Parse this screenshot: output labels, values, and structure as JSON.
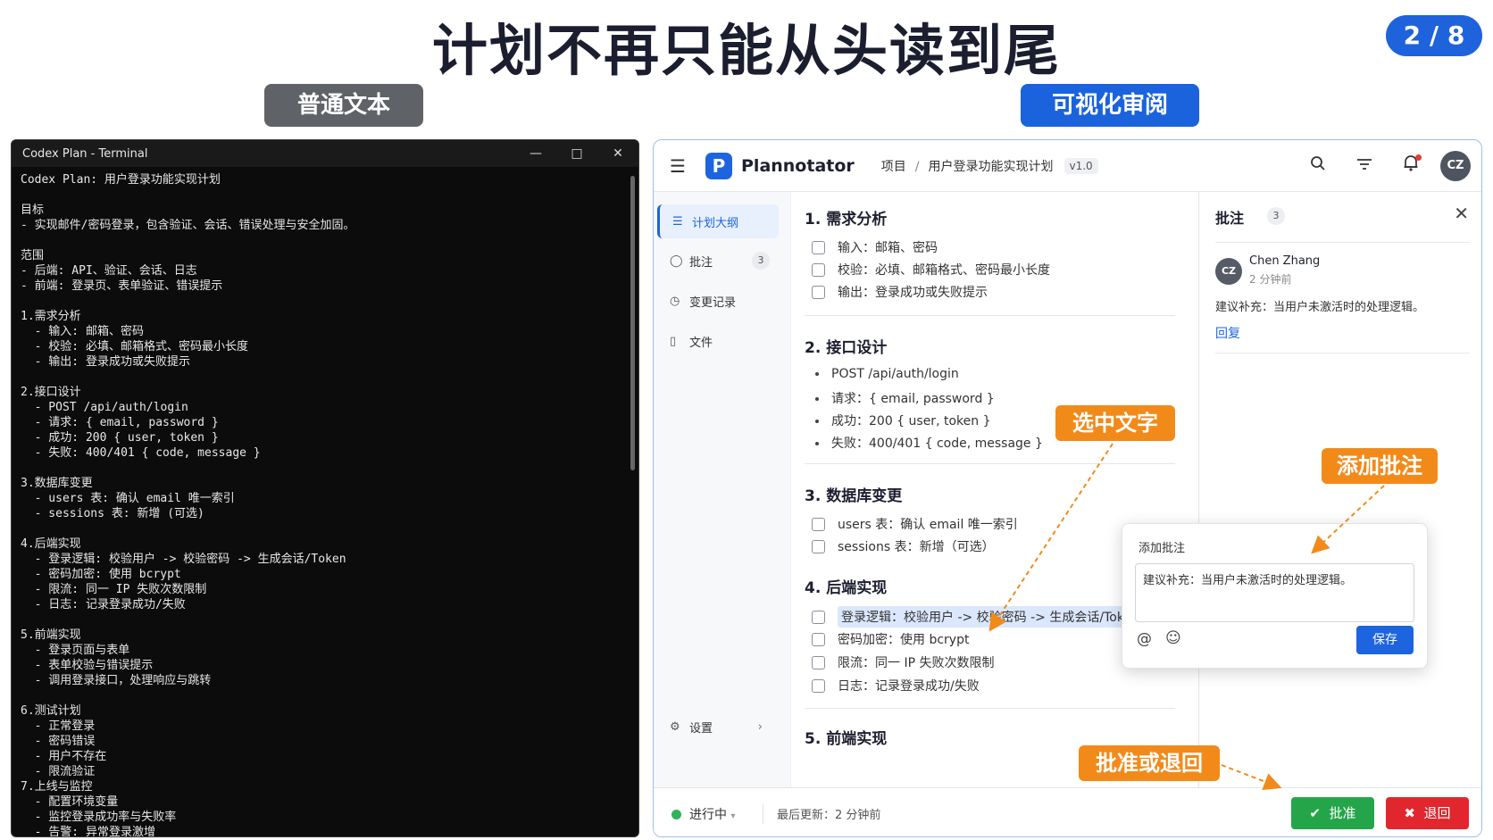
{
  "slide": {
    "title": "计划不再只能从头读到尾",
    "page": "2 / 8",
    "label_plain": "普通文本",
    "label_visual": "可视化审阅"
  },
  "terminal": {
    "window_title": "Codex Plan - Terminal",
    "lines": [
      "Codex Plan: 用户登录功能实现计划",
      "",
      "目标",
      "- 实现邮件/密码登录，包含验证、会话、错误处理与安全加固。",
      "",
      "范围",
      "- 后端: API、验证、会话、日志",
      "- 前端: 登录页、表单验证、错误提示",
      "",
      "1.需求分析",
      "  - 输入: 邮箱、密码",
      "  - 校验: 必填、邮箱格式、密码最小长度",
      "  - 输出: 登录成功或失败提示",
      "",
      "2.接口设计",
      "  - POST /api/auth/login",
      "  - 请求: { email, password }",
      "  - 成功: 200 { user, token }",
      "  - 失败: 400/401 { code, message }",
      "",
      "3.数据库变更",
      "  - users 表: 确认 email 唯一索引",
      "  - sessions 表: 新增 (可选)",
      "",
      "4.后端实现",
      "  - 登录逻辑: 校验用户 -> 校验密码 -> 生成会话/Token",
      "  - 密码加密: 使用 bcrypt",
      "  - 限流: 同一 IP 失败次数限制",
      "  - 日志: 记录登录成功/失败",
      "",
      "5.前端实现",
      "  - 登录页面与表单",
      "  - 表单校验与错误提示",
      "  - 调用登录接口，处理响应与跳转",
      "",
      "6.测试计划",
      "  - 正常登录",
      "  - 密码错误",
      "  - 用户不存在",
      "  - 限流验证",
      "7.上线与监控",
      "  - 配置环境变量",
      "  - 监控登录成功率与失败率",
      "  - 告警: 异常登录激增"
    ]
  },
  "app": {
    "brand": "Plannotator",
    "logo_letter": "P",
    "breadcrumb": {
      "root": "项目",
      "sep": "/",
      "current": "用户登录功能实现计划",
      "version": "v1.0"
    },
    "user_initials": "CZ",
    "sidebar": {
      "items": [
        {
          "label": "计划大纲",
          "icon": "list-icon"
        },
        {
          "label": "批注",
          "icon": "comment-icon",
          "count": "3"
        },
        {
          "label": "变更记录",
          "icon": "history-icon"
        },
        {
          "label": "文件",
          "icon": "file-icon"
        }
      ],
      "settings": "设置"
    },
    "plan": {
      "s1": {
        "title": "1. 需求分析",
        "items": [
          "输入：邮箱、密码",
          "校验：必填、邮箱格式、密码最小长度",
          "输出：登录成功或失败提示"
        ]
      },
      "s2": {
        "title": "2. 接口设计",
        "items": [
          "POST /api/auth/login",
          "请求：{ email, password }",
          "成功：200 { user, token }",
          "失败：400/401 { code, message }"
        ]
      },
      "s3": {
        "title": "3. 数据库变更",
        "items": [
          "users 表：确认 email 唯一索引",
          "sessions 表：新增（可选）"
        ]
      },
      "s4": {
        "title": "4. 后端实现",
        "items": [
          "登录逻辑：校验用户 -> 校验密码 -> 生成会话/Token",
          "密码加密：使用 bcrypt",
          "限流：同一 IP 失败次数限制",
          "日志：记录登录成功/失败"
        ]
      },
      "s5": {
        "title": "5. 前端实现"
      }
    },
    "comments_panel": {
      "title": "批注",
      "count": "3",
      "comment": {
        "initials": "CZ",
        "author": "Chen Zhang",
        "time": "2 分钟前",
        "text": "建议补充：当用户未激活时的处理逻辑。",
        "reply": "回复"
      }
    },
    "popup": {
      "title": "添加批注",
      "text": "建议补充：当用户未激活时的处理逻辑。",
      "save": "保存"
    },
    "status": {
      "state": "进行中",
      "updated": "最后更新：2 分钟前",
      "approve": "批准",
      "reject": "退回"
    }
  },
  "callouts": {
    "select": "选中文字",
    "add": "添加批注",
    "approve": "批准或退回"
  },
  "colors": {
    "accent": "#1d64df",
    "callout": "#f28a1a",
    "approve": "#25a54a",
    "reject": "#e1262d"
  }
}
